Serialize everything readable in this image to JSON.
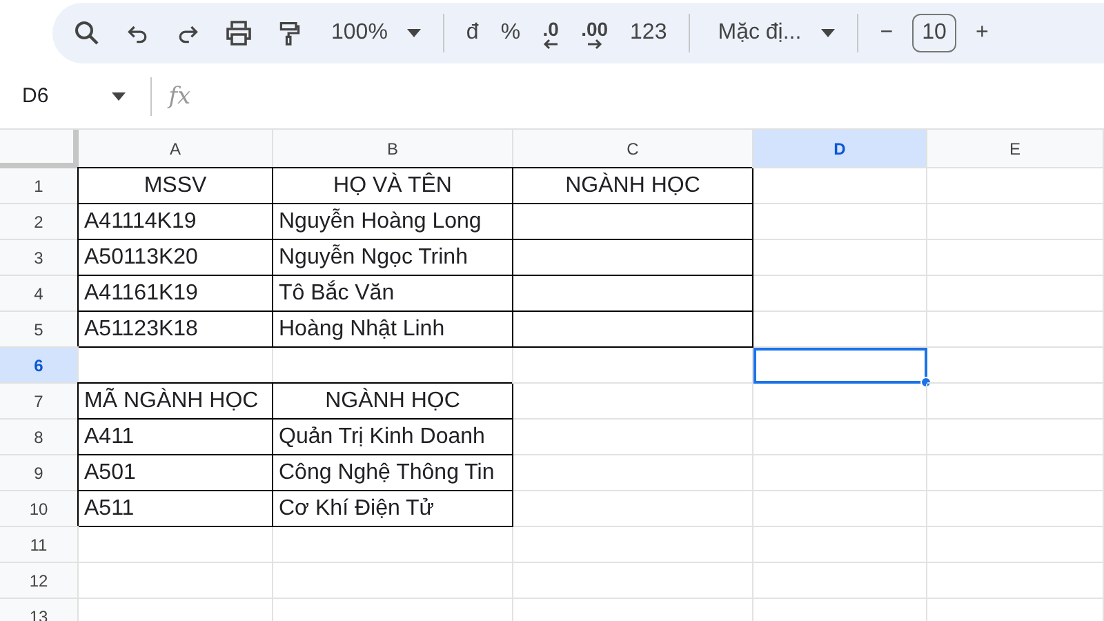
{
  "toolbar": {
    "items": [
      {
        "kind": "search"
      },
      {
        "kind": "undo"
      },
      {
        "kind": "redo"
      },
      {
        "kind": "print"
      },
      {
        "kind": "paint"
      },
      {
        "kind": "dropdown",
        "label": "100%"
      },
      {
        "kind": "divider"
      },
      {
        "kind": "text",
        "label": "đ"
      },
      {
        "kind": "text",
        "label": "%"
      },
      {
        "kind": "fewer",
        "label": ".0"
      },
      {
        "kind": "more",
        "label": ".00"
      },
      {
        "kind": "text",
        "label": "123"
      },
      {
        "kind": "divider"
      },
      {
        "kind": "dropdown",
        "label": "Mặc đị..."
      },
      {
        "kind": "divider"
      },
      {
        "kind": "text",
        "label": "−"
      },
      {
        "kind": "field",
        "label": "10"
      },
      {
        "kind": "text",
        "label": "+"
      }
    ]
  },
  "formula_bar": {
    "name_box": "D6",
    "fx": "fx"
  },
  "sheet": {
    "columns": [
      {
        "label": "A",
        "selected": false
      },
      {
        "label": "B",
        "selected": false
      },
      {
        "label": "C",
        "selected": false
      },
      {
        "label": "D",
        "selected": true
      },
      {
        "label": "E",
        "selected": false
      }
    ],
    "rows": [
      {
        "label": "1",
        "selected": false,
        "cells": [
          {
            "text": "MSSV",
            "centered": true,
            "bordered": true
          },
          {
            "text": "HỌ VÀ TÊN",
            "centered": true,
            "bordered": true
          },
          {
            "text": "NGÀNH HỌC",
            "centered": true,
            "bordered": true
          }
        ]
      },
      {
        "label": "2",
        "selected": false,
        "cells": [
          {
            "text": "A41114K19",
            "bordered": true
          },
          {
            "text": "Nguyễn Hoàng Long",
            "bordered": true
          },
          {
            "bordered": true
          }
        ]
      },
      {
        "label": "3",
        "selected": false,
        "cells": [
          {
            "text": "A50113K20",
            "bordered": true
          },
          {
            "text": "Nguyễn Ngọc Trinh",
            "bordered": true
          },
          {
            "bordered": true
          }
        ]
      },
      {
        "label": "4",
        "selected": false,
        "cells": [
          {
            "text": "A41161K19",
            "bordered": true
          },
          {
            "text": "Tô Bắc Văn",
            "bordered": true
          },
          {
            "bordered": true
          }
        ]
      },
      {
        "label": "5",
        "selected": false,
        "cells": [
          {
            "text": "A51123K18",
            "bordered": true
          },
          {
            "text": "Hoàng Nhật Linh",
            "bordered": true
          },
          {
            "bordered": true
          }
        ]
      },
      {
        "label": "6",
        "selected": true
      },
      {
        "label": "7",
        "selected": false,
        "cells": [
          {
            "text": "MÃ NGÀNH HỌC",
            "bordered": true
          },
          {
            "text": "NGÀNH HỌC",
            "centered": true,
            "bordered": true
          }
        ]
      },
      {
        "label": "8",
        "selected": false,
        "cells": [
          {
            "text": "A411",
            "bordered": true
          },
          {
            "text": "Quản Trị Kinh Doanh",
            "bordered": true
          }
        ]
      },
      {
        "label": "9",
        "selected": false,
        "cells": [
          {
            "text": "A501",
            "bordered": true
          },
          {
            "text": "Công Nghệ Thông Tin",
            "bordered": true
          }
        ]
      },
      {
        "label": "10",
        "selected": false,
        "cells": [
          {
            "text": "A511",
            "bordered": true
          },
          {
            "text": "Cơ Khí Điện Tử",
            "bordered": true
          }
        ]
      },
      {
        "label": "11",
        "selected": false
      },
      {
        "label": "12",
        "selected": false
      },
      {
        "label": "13",
        "selected": false
      }
    ]
  }
}
